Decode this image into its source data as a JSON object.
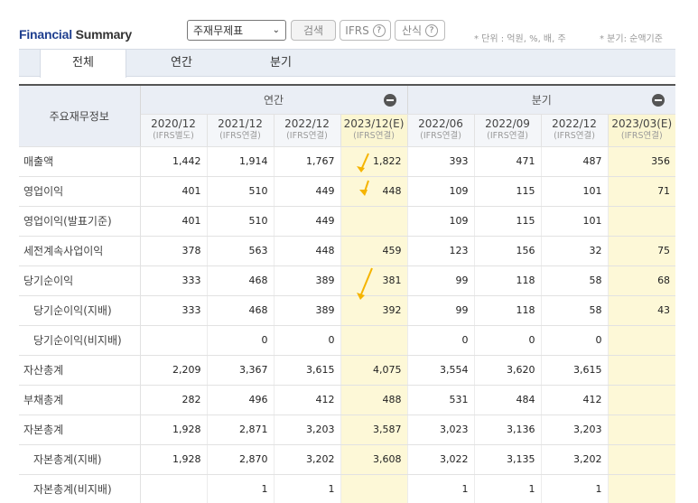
{
  "header": {
    "title_bold": "Financial",
    "title_rest": " Summary",
    "select_value": "주재무제표",
    "search_label": "검색",
    "ifrs_label": "IFRS",
    "formula_label": "산식",
    "help_icon_glyph": "?",
    "unit_text": "* 단위 : 억원, %, 배, 주",
    "basis_text": "* 분기: 순액기준"
  },
  "tabs": [
    {
      "label": "전체"
    },
    {
      "label": "연간"
    },
    {
      "label": "분기"
    }
  ],
  "table": {
    "row_header": "주요재무정보",
    "group_annual": "연간",
    "group_quarter": "분기",
    "columns": [
      {
        "period": "2020/12",
        "basis": "(IFRS별도)"
      },
      {
        "period": "2021/12",
        "basis": "(IFRS연결)"
      },
      {
        "period": "2022/12",
        "basis": "(IFRS연결)"
      },
      {
        "period": "2023/12(E)",
        "basis": "(IFRS연결)"
      },
      {
        "period": "2022/06",
        "basis": "(IFRS연결)"
      },
      {
        "period": "2022/09",
        "basis": "(IFRS연결)"
      },
      {
        "period": "2022/12",
        "basis": "(IFRS연결)"
      },
      {
        "period": "2023/03(E)",
        "basis": "(IFRS연결)"
      }
    ],
    "rows": [
      {
        "label": "매출액",
        "values": [
          "1,442",
          "1,914",
          "1,767",
          "1,822",
          "393",
          "471",
          "487",
          "356"
        ]
      },
      {
        "label": "영업이익",
        "values": [
          "401",
          "510",
          "449",
          "448",
          "109",
          "115",
          "101",
          "71"
        ]
      },
      {
        "label": "영업이익(발표기준)",
        "values": [
          "401",
          "510",
          "449",
          "",
          "109",
          "115",
          "101",
          ""
        ]
      },
      {
        "label": "세전계속사업이익",
        "values": [
          "378",
          "563",
          "448",
          "459",
          "123",
          "156",
          "32",
          "75"
        ]
      },
      {
        "label": "당기순이익",
        "values": [
          "333",
          "468",
          "389",
          "381",
          "99",
          "118",
          "58",
          "68"
        ]
      },
      {
        "label": "당기순이익(지배)",
        "values": [
          "333",
          "468",
          "389",
          "392",
          "99",
          "118",
          "58",
          "43"
        ]
      },
      {
        "label": "당기순이익(비지배)",
        "values": [
          "",
          "0",
          "0",
          "",
          "0",
          "0",
          "0",
          ""
        ]
      },
      {
        "label": "자산총계",
        "values": [
          "2,209",
          "3,367",
          "3,615",
          "4,075",
          "3,554",
          "3,620",
          "3,615",
          ""
        ]
      },
      {
        "label": "부채총계",
        "values": [
          "282",
          "496",
          "412",
          "488",
          "531",
          "484",
          "412",
          ""
        ]
      },
      {
        "label": "자본총계",
        "values": [
          "1,928",
          "2,871",
          "3,203",
          "3,587",
          "3,023",
          "3,136",
          "3,203",
          ""
        ]
      },
      {
        "label": "자본총계(지배)",
        "values": [
          "1,928",
          "2,870",
          "3,202",
          "3,608",
          "3,022",
          "3,135",
          "3,202",
          ""
        ]
      },
      {
        "label": "자본총계(비지배)",
        "values": [
          "",
          "1",
          "1",
          "",
          "1",
          "1",
          "1",
          ""
        ]
      }
    ]
  },
  "colors": {
    "brand": "#1f3f8f",
    "estimate_bg": "#fdf8d7",
    "arrow": "#f5b400"
  }
}
